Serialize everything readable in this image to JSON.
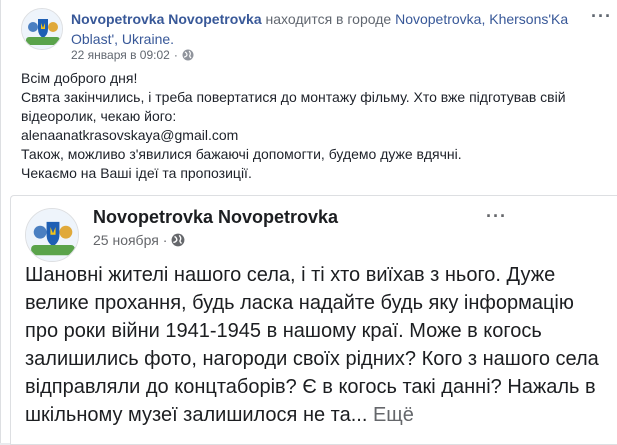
{
  "post": {
    "author": "Novopetrovka Novopetrovka",
    "location_prefix": "находится в городе",
    "location": "Novopetrovka, Khersons'Ka Oblast', Ukraine.",
    "timestamp": "22 января в 09:02",
    "dot": "·",
    "text": "Всім доброго дня!\nСвята закінчились, і треба повертатися до монтажу фільму. Хто вже підготував свій відеоролик, чекаю його:\nalenaanatkrasovskaya@gmail.com\nТакож, можливо з'явилися бажаючі допомогти, будемо дуже вдячні.\nЧекаємо на Ваші ідеї та пропозиції.",
    "more_glyph": "···"
  },
  "shared_post": {
    "author": "Novopetrovka Novopetrovka",
    "timestamp": "25 ноября",
    "dot": "·",
    "text": "Шановні жителі нашого села, і ті хто виїхав з нього. Дуже велике прохання, будь ласка надайте будь яку інформацію про роки війни 1941-1945 в нашому краї. Може в когось залишились фото, нагороди своїх рідних? Кого з нашого села відправляли до концтаборів? Є в когось такі данні? Нажаль в шкільному музеї залишилося не та...",
    "see_more": "Ещё",
    "more_glyph": "···"
  },
  "icons": {
    "visibility": "globe-icon",
    "options": "more-options-icon"
  },
  "colors": {
    "link": "#385898",
    "secondary": "#616770",
    "text": "#1d2129",
    "border": "#dddfe2"
  }
}
